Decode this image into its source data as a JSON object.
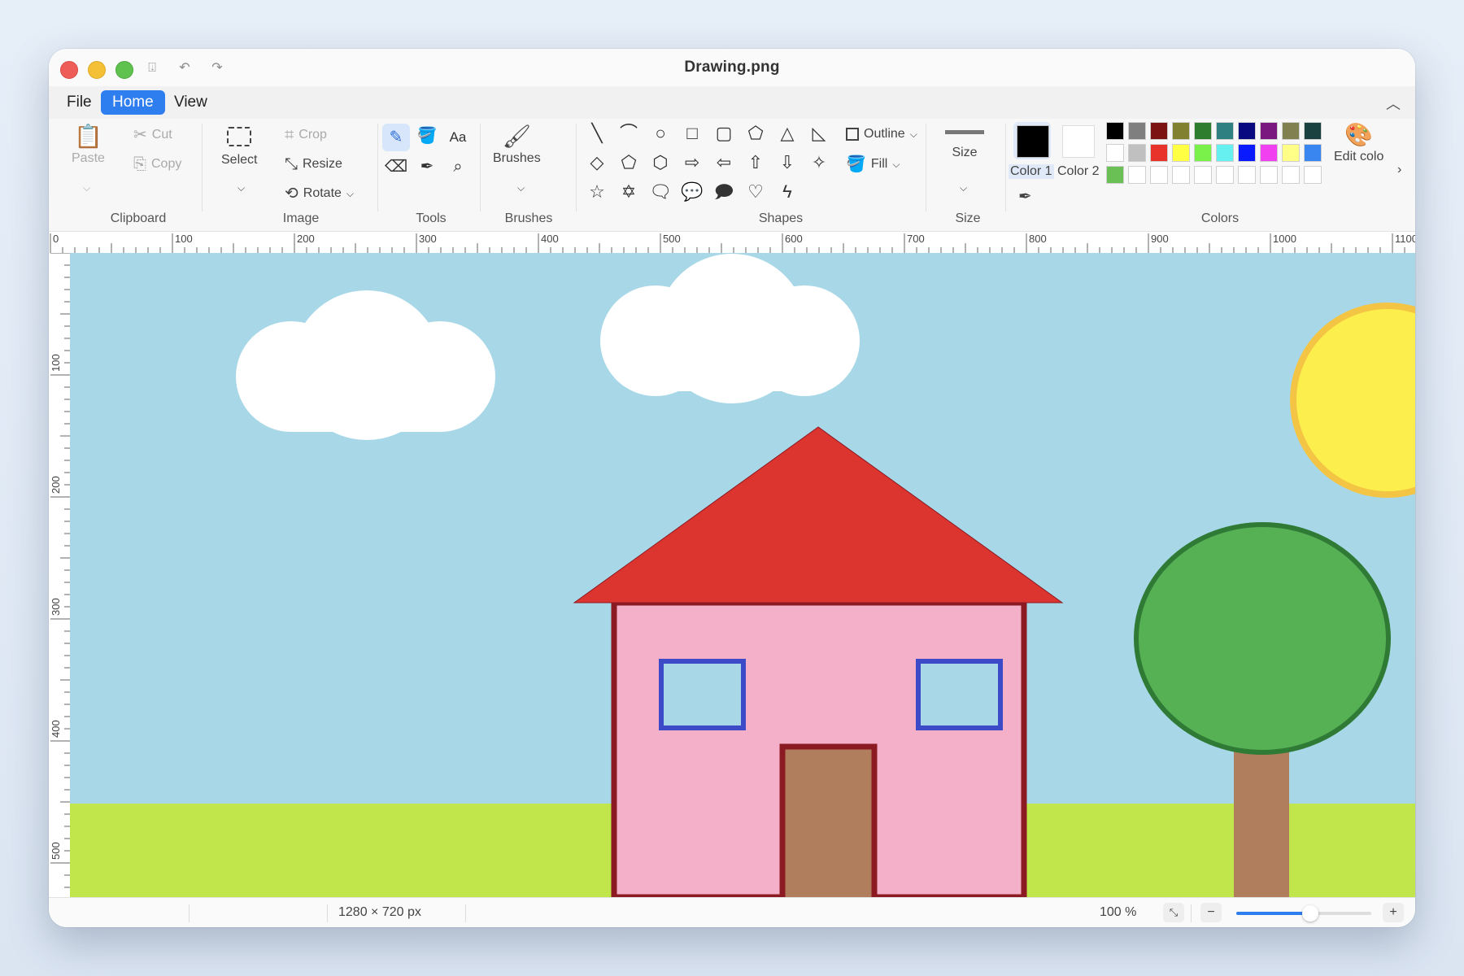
{
  "window": {
    "title": "Drawing.png"
  },
  "menu": {
    "file": "File",
    "home": "Home",
    "view": "View"
  },
  "clipboard": {
    "label": "Clipboard",
    "paste": "Paste",
    "cut": "Cut",
    "copy": "Copy"
  },
  "image": {
    "label": "Image",
    "select": "Select",
    "crop": "Crop",
    "resize": "Resize",
    "rotate": "Rotate"
  },
  "tools": {
    "label": "Tools",
    "text_tool": "Aa"
  },
  "brushes": {
    "label": "Brushes",
    "brushes": "Brushes"
  },
  "shapes": {
    "label": "Shapes",
    "outline": "Outline",
    "fill": "Fill"
  },
  "size": {
    "label": "Size",
    "size": "Size"
  },
  "colors": {
    "label": "Colors",
    "color1": "Color 1",
    "color2": "Color 2",
    "edit_colors": "Edit colo",
    "color1_value": "#000000",
    "color2_value": "#ffffff",
    "palette_row1": [
      "#000000",
      "#7f7f7f",
      "#7c1414",
      "#808030",
      "#2e7d2e",
      "#2f8080",
      "#0a0a80",
      "#7a1880",
      "#808050",
      "#1a4040"
    ],
    "palette_row2": [
      "#ffffff",
      "#c0c0c0",
      "#e8332a",
      "#ffff44",
      "#7af04a",
      "#66f0f0",
      "#0a1aff",
      "#f040f0",
      "#ffff88",
      "#3a86f0"
    ],
    "palette_row3": [
      "#6abf55",
      "#ffffff",
      "#ffffff",
      "#ffffff",
      "#ffffff",
      "#ffffff",
      "#ffffff",
      "#ffffff",
      "#ffffff",
      "#ffffff"
    ]
  },
  "ruler": {
    "h_labels": [
      "0",
      "100",
      "200",
      "300",
      "400",
      "500",
      "600",
      "700",
      "800",
      "900",
      "1000",
      "1100"
    ],
    "v_labels": [
      "100",
      "200",
      "300",
      "400",
      "500"
    ]
  },
  "status": {
    "dimensions": "1280 × 720 px",
    "zoom": "100 %",
    "zoom_level": 0.55,
    "minus": "−",
    "plus": "+"
  },
  "drawing": {
    "sky": "#a8d8e8",
    "grass": "#c0e64c",
    "house_wall": "#f4b0c8",
    "house_outline": "#8b1a22",
    "roof": "#dc3530",
    "window_frame": "#3c4ac8",
    "door": "#b07e5c",
    "sun": "#fcee4c",
    "sun_outline": "#f4c444",
    "tree_crown": "#56b054",
    "tree_outline": "#2f7a34",
    "trunk": "#b07e5c"
  }
}
